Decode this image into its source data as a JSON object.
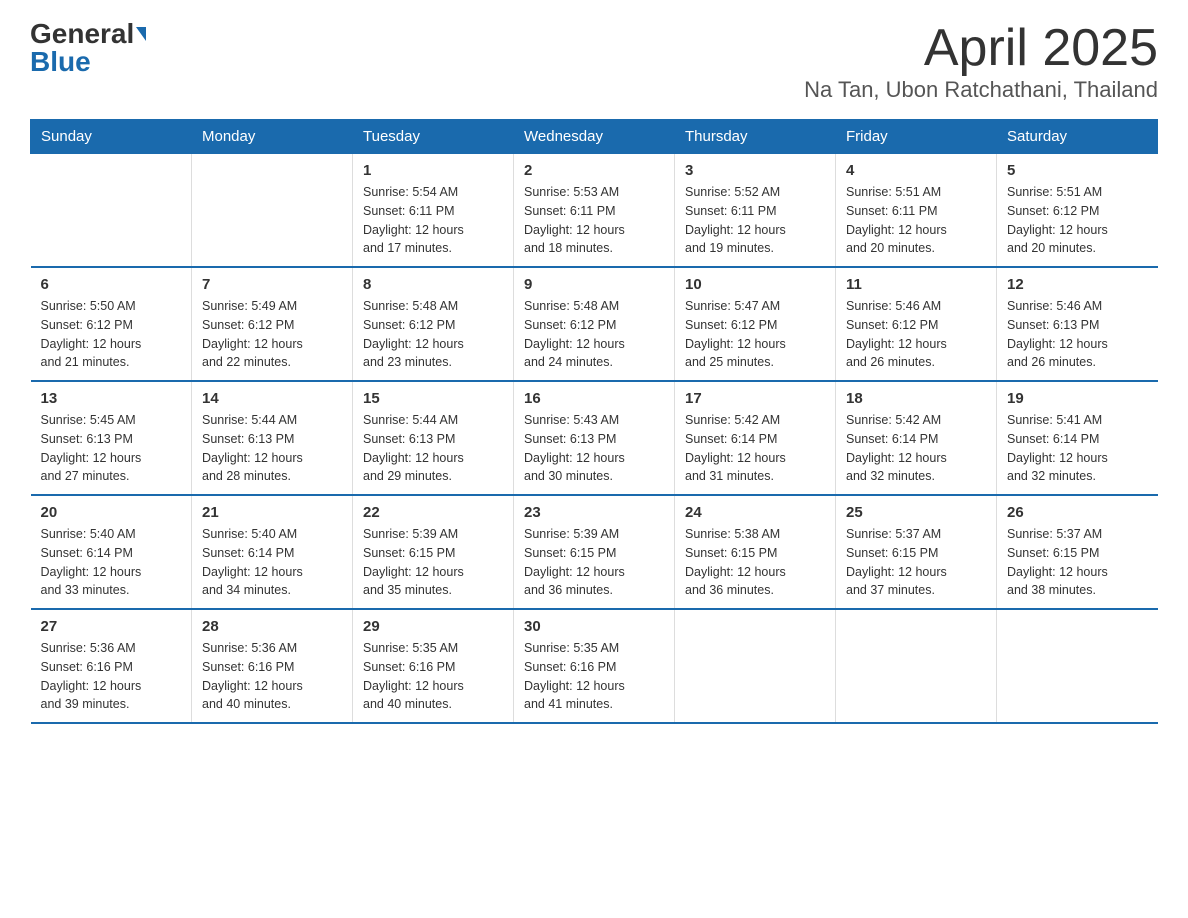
{
  "header": {
    "logo_general": "General",
    "logo_blue": "Blue",
    "month_title": "April 2025",
    "location": "Na Tan, Ubon Ratchathani, Thailand"
  },
  "weekdays": [
    "Sunday",
    "Monday",
    "Tuesday",
    "Wednesday",
    "Thursday",
    "Friday",
    "Saturday"
  ],
  "weeks": [
    [
      {
        "day": "",
        "info": ""
      },
      {
        "day": "",
        "info": ""
      },
      {
        "day": "1",
        "info": "Sunrise: 5:54 AM\nSunset: 6:11 PM\nDaylight: 12 hours\nand 17 minutes."
      },
      {
        "day": "2",
        "info": "Sunrise: 5:53 AM\nSunset: 6:11 PM\nDaylight: 12 hours\nand 18 minutes."
      },
      {
        "day": "3",
        "info": "Sunrise: 5:52 AM\nSunset: 6:11 PM\nDaylight: 12 hours\nand 19 minutes."
      },
      {
        "day": "4",
        "info": "Sunrise: 5:51 AM\nSunset: 6:11 PM\nDaylight: 12 hours\nand 20 minutes."
      },
      {
        "day": "5",
        "info": "Sunrise: 5:51 AM\nSunset: 6:12 PM\nDaylight: 12 hours\nand 20 minutes."
      }
    ],
    [
      {
        "day": "6",
        "info": "Sunrise: 5:50 AM\nSunset: 6:12 PM\nDaylight: 12 hours\nand 21 minutes."
      },
      {
        "day": "7",
        "info": "Sunrise: 5:49 AM\nSunset: 6:12 PM\nDaylight: 12 hours\nand 22 minutes."
      },
      {
        "day": "8",
        "info": "Sunrise: 5:48 AM\nSunset: 6:12 PM\nDaylight: 12 hours\nand 23 minutes."
      },
      {
        "day": "9",
        "info": "Sunrise: 5:48 AM\nSunset: 6:12 PM\nDaylight: 12 hours\nand 24 minutes."
      },
      {
        "day": "10",
        "info": "Sunrise: 5:47 AM\nSunset: 6:12 PM\nDaylight: 12 hours\nand 25 minutes."
      },
      {
        "day": "11",
        "info": "Sunrise: 5:46 AM\nSunset: 6:12 PM\nDaylight: 12 hours\nand 26 minutes."
      },
      {
        "day": "12",
        "info": "Sunrise: 5:46 AM\nSunset: 6:13 PM\nDaylight: 12 hours\nand 26 minutes."
      }
    ],
    [
      {
        "day": "13",
        "info": "Sunrise: 5:45 AM\nSunset: 6:13 PM\nDaylight: 12 hours\nand 27 minutes."
      },
      {
        "day": "14",
        "info": "Sunrise: 5:44 AM\nSunset: 6:13 PM\nDaylight: 12 hours\nand 28 minutes."
      },
      {
        "day": "15",
        "info": "Sunrise: 5:44 AM\nSunset: 6:13 PM\nDaylight: 12 hours\nand 29 minutes."
      },
      {
        "day": "16",
        "info": "Sunrise: 5:43 AM\nSunset: 6:13 PM\nDaylight: 12 hours\nand 30 minutes."
      },
      {
        "day": "17",
        "info": "Sunrise: 5:42 AM\nSunset: 6:14 PM\nDaylight: 12 hours\nand 31 minutes."
      },
      {
        "day": "18",
        "info": "Sunrise: 5:42 AM\nSunset: 6:14 PM\nDaylight: 12 hours\nand 32 minutes."
      },
      {
        "day": "19",
        "info": "Sunrise: 5:41 AM\nSunset: 6:14 PM\nDaylight: 12 hours\nand 32 minutes."
      }
    ],
    [
      {
        "day": "20",
        "info": "Sunrise: 5:40 AM\nSunset: 6:14 PM\nDaylight: 12 hours\nand 33 minutes."
      },
      {
        "day": "21",
        "info": "Sunrise: 5:40 AM\nSunset: 6:14 PM\nDaylight: 12 hours\nand 34 minutes."
      },
      {
        "day": "22",
        "info": "Sunrise: 5:39 AM\nSunset: 6:15 PM\nDaylight: 12 hours\nand 35 minutes."
      },
      {
        "day": "23",
        "info": "Sunrise: 5:39 AM\nSunset: 6:15 PM\nDaylight: 12 hours\nand 36 minutes."
      },
      {
        "day": "24",
        "info": "Sunrise: 5:38 AM\nSunset: 6:15 PM\nDaylight: 12 hours\nand 36 minutes."
      },
      {
        "day": "25",
        "info": "Sunrise: 5:37 AM\nSunset: 6:15 PM\nDaylight: 12 hours\nand 37 minutes."
      },
      {
        "day": "26",
        "info": "Sunrise: 5:37 AM\nSunset: 6:15 PM\nDaylight: 12 hours\nand 38 minutes."
      }
    ],
    [
      {
        "day": "27",
        "info": "Sunrise: 5:36 AM\nSunset: 6:16 PM\nDaylight: 12 hours\nand 39 minutes."
      },
      {
        "day": "28",
        "info": "Sunrise: 5:36 AM\nSunset: 6:16 PM\nDaylight: 12 hours\nand 40 minutes."
      },
      {
        "day": "29",
        "info": "Sunrise: 5:35 AM\nSunset: 6:16 PM\nDaylight: 12 hours\nand 40 minutes."
      },
      {
        "day": "30",
        "info": "Sunrise: 5:35 AM\nSunset: 6:16 PM\nDaylight: 12 hours\nand 41 minutes."
      },
      {
        "day": "",
        "info": ""
      },
      {
        "day": "",
        "info": ""
      },
      {
        "day": "",
        "info": ""
      }
    ]
  ]
}
